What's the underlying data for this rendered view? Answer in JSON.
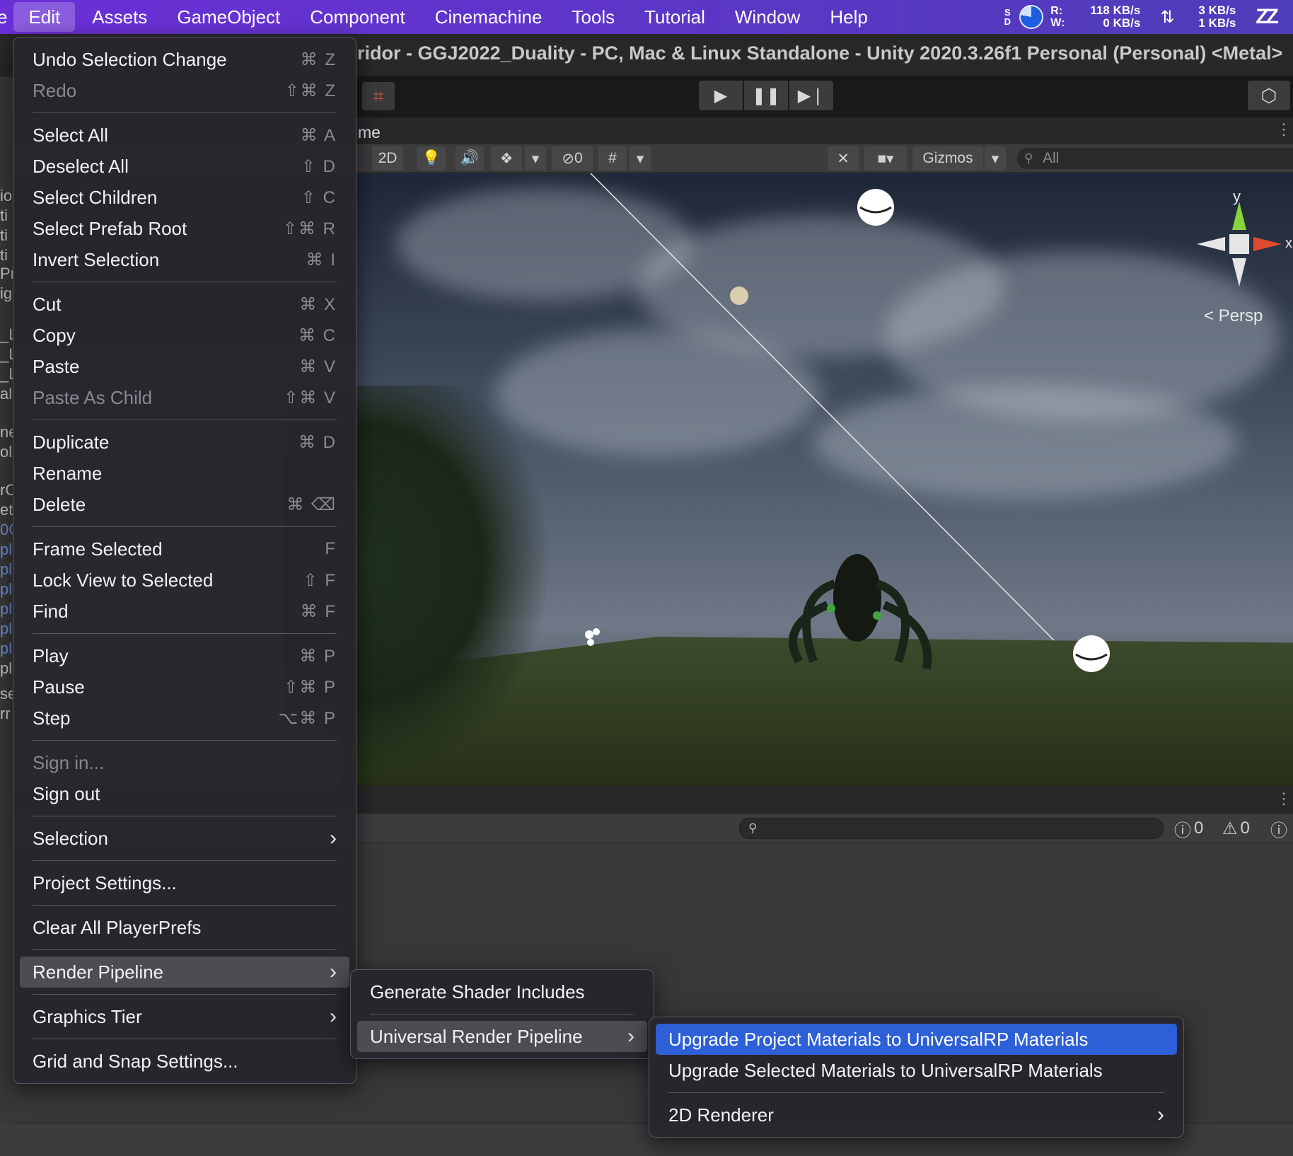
{
  "menubar": {
    "partial_first": "e",
    "items": [
      "Edit",
      "Assets",
      "GameObject",
      "Component",
      "Cinemachine",
      "Tools",
      "Tutorial",
      "Window",
      "Help"
    ],
    "status": {
      "sd": "S\nD",
      "rw": "R:\nW:",
      "disk_r": "118 KB/s",
      "disk_w": "0 KB/s",
      "net_arrow": "⇅",
      "net_up": "3 KB/s",
      "net_down": "1 KB/s",
      "sleep": "ZZ"
    }
  },
  "window_title": "ridor - GGJ2022_Duality - PC, Mac & Linux Standalone - Unity 2020.3.26f1 Personal (Personal) <Metal>",
  "scene_tab": {
    "partial_label": "me"
  },
  "scene_toolbar": {
    "mode_2d": "2D",
    "hidden_count": "0",
    "gizmos": "Gizmos",
    "search_placeholder": "All"
  },
  "gizmo": {
    "y": "y",
    "x": "x",
    "persp": "< Persp"
  },
  "console": {
    "error_count": "0",
    "warning_count": "0"
  },
  "left_sliver": [
    "io",
    "ti",
    "ti",
    "ti",
    "Pr",
    "ig",
    "_L",
    "_L",
    "_L",
    "al",
    "ne",
    "oll",
    "rC",
    "et",
    "0C",
    "pl",
    "pl",
    "pl",
    "pl",
    "pl",
    "pl",
    "pl",
    "se",
    "rr"
  ],
  "edit_menu": [
    {
      "label": "Undo Selection Change",
      "shortcut": "⌘ Z"
    },
    {
      "label": "Redo",
      "shortcut": "⇧⌘ Z",
      "disabled": true
    },
    {
      "sep": true
    },
    {
      "label": "Select All",
      "shortcut": "⌘ A"
    },
    {
      "label": "Deselect All",
      "shortcut": "⇧ D"
    },
    {
      "label": "Select Children",
      "shortcut": "⇧ C"
    },
    {
      "label": "Select Prefab Root",
      "shortcut": "⇧⌘ R"
    },
    {
      "label": "Invert Selection",
      "shortcut": "⌘ I"
    },
    {
      "sep": true
    },
    {
      "label": "Cut",
      "shortcut": "⌘ X"
    },
    {
      "label": "Copy",
      "shortcut": "⌘ C"
    },
    {
      "label": "Paste",
      "shortcut": "⌘ V"
    },
    {
      "label": "Paste As Child",
      "shortcut": "⇧⌘ V",
      "disabled": true
    },
    {
      "sep": true
    },
    {
      "label": "Duplicate",
      "shortcut": "⌘ D"
    },
    {
      "label": "Rename",
      "shortcut": ""
    },
    {
      "label": "Delete",
      "shortcut": "⌘ ⌫"
    },
    {
      "sep": true
    },
    {
      "label": "Frame Selected",
      "shortcut": "F"
    },
    {
      "label": "Lock View to Selected",
      "shortcut": "⇧ F"
    },
    {
      "label": "Find",
      "shortcut": "⌘ F"
    },
    {
      "sep": true
    },
    {
      "label": "Play",
      "shortcut": "⌘ P"
    },
    {
      "label": "Pause",
      "shortcut": "⇧⌘ P"
    },
    {
      "label": "Step",
      "shortcut": "⌥⌘ P"
    },
    {
      "sep": true
    },
    {
      "label": "Sign in...",
      "shortcut": "",
      "disabled": true
    },
    {
      "label": "Sign out",
      "shortcut": ""
    },
    {
      "sep": true
    },
    {
      "label": "Selection",
      "submenu": true
    },
    {
      "sep": true
    },
    {
      "label": "Project Settings...",
      "shortcut": ""
    },
    {
      "sep": true
    },
    {
      "label": "Clear All PlayerPrefs",
      "shortcut": ""
    },
    {
      "sep": true
    },
    {
      "label": "Render Pipeline",
      "submenu": true,
      "highlighted": true
    },
    {
      "sep": true
    },
    {
      "label": "Graphics Tier",
      "submenu": true
    },
    {
      "sep": true
    },
    {
      "label": "Grid and Snap Settings...",
      "shortcut": ""
    }
  ],
  "render_pipeline_menu": [
    {
      "label": "Generate Shader Includes"
    },
    {
      "sep": true
    },
    {
      "label": "Universal Render Pipeline",
      "submenu": true,
      "highlighted": true
    }
  ],
  "urp_menu": [
    {
      "label": "Upgrade Project Materials to UniversalRP Materials",
      "selected": true
    },
    {
      "label": "Upgrade Selected Materials to UniversalRP Materials"
    },
    {
      "sep": true
    },
    {
      "label": "2D Renderer",
      "submenu": true
    }
  ]
}
